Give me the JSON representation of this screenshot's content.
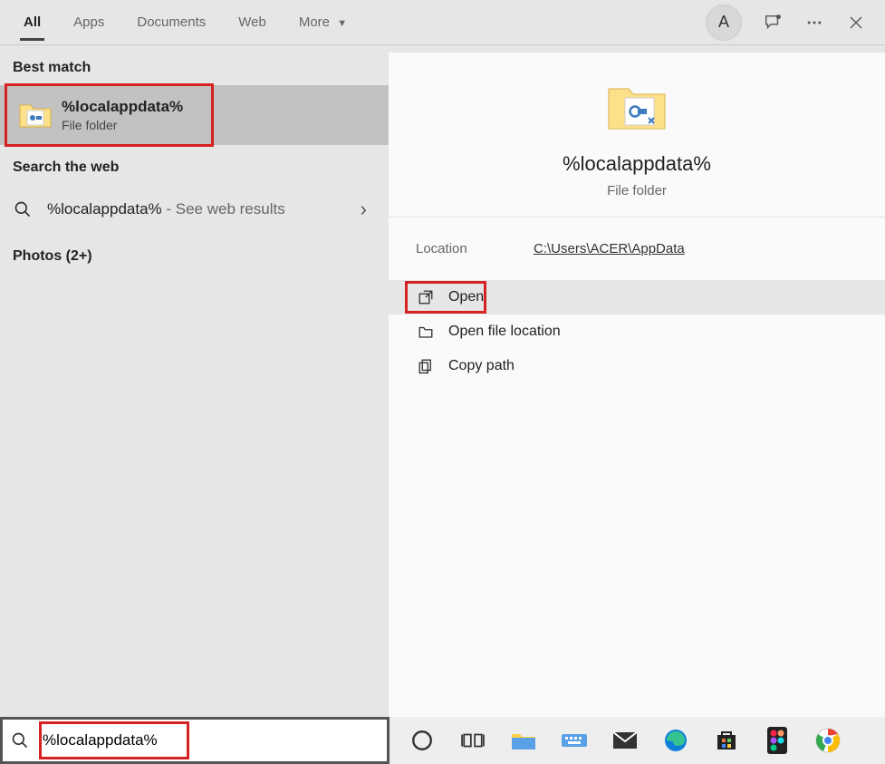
{
  "header": {
    "tabs": {
      "all": "All",
      "apps": "Apps",
      "documents": "Documents",
      "web": "Web",
      "more": "More"
    },
    "avatar_letter": "A"
  },
  "left": {
    "best_match_header": "Best match",
    "best_match": {
      "title": "%localappdata%",
      "sub": "File folder"
    },
    "search_web_header": "Search the web",
    "web_result": {
      "query": "%localappdata%",
      "suffix": " - See web results"
    },
    "photos_header": "Photos (2+)"
  },
  "right": {
    "title": "%localappdata%",
    "sub": "File folder",
    "location_label": "Location",
    "location_value": "C:\\Users\\ACER\\AppData",
    "actions": {
      "open": "Open",
      "open_location": "Open file location",
      "copy_path": "Copy path"
    }
  },
  "search": {
    "value": "%localappdata%"
  }
}
